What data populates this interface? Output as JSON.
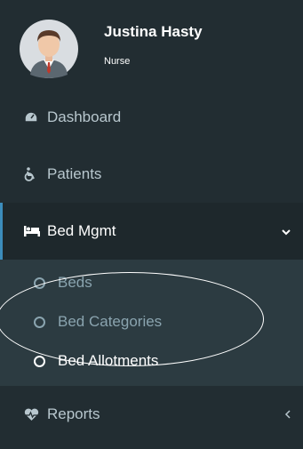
{
  "user": {
    "name": "Justina Hasty",
    "role": "Nurse"
  },
  "menu": {
    "dashboard": {
      "label": "Dashboard",
      "icon": "dashboard-icon"
    },
    "patients": {
      "label": "Patients",
      "icon": "wheelchair-icon"
    },
    "bed_mgmt": {
      "label": "Bed Mgmt",
      "icon": "bed-icon",
      "expanded": true,
      "items": [
        {
          "label": "Beds"
        },
        {
          "label": "Bed Categories"
        },
        {
          "label": "Bed Allotments",
          "selected": true
        }
      ]
    },
    "reports": {
      "label": "Reports",
      "icon": "heartbeat-icon"
    }
  },
  "colors": {
    "sidebar": "#222d32",
    "active": "#1e282c",
    "submenu": "#2c3b41",
    "accent": "#3c8dbc"
  }
}
